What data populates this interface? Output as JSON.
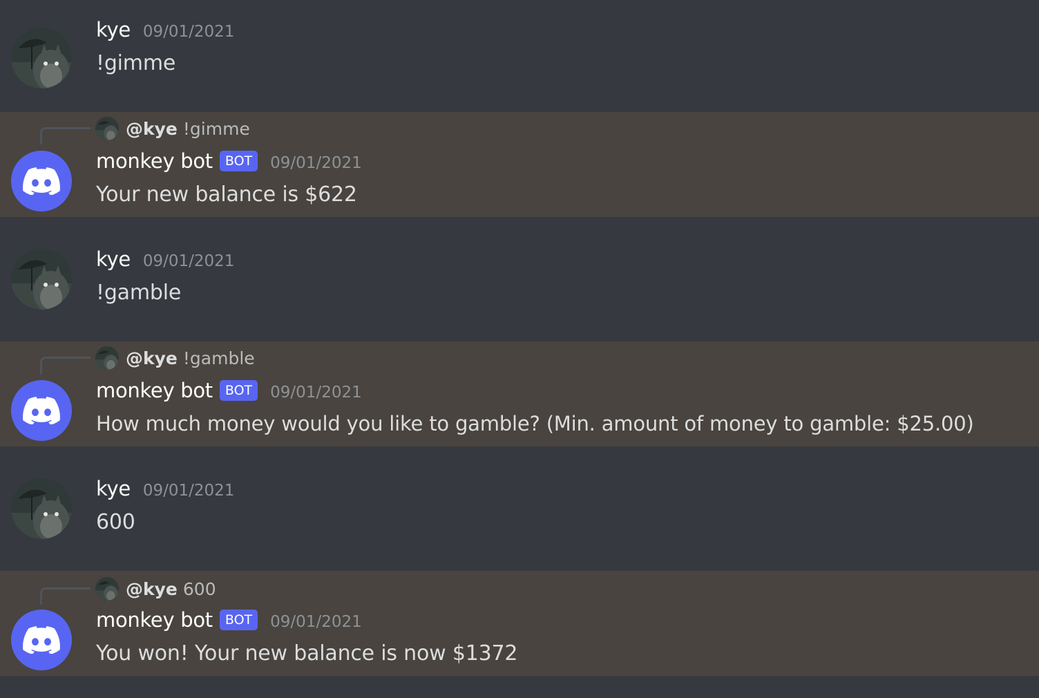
{
  "channel": {
    "messages": [
      {
        "author": "kye",
        "timestamp": "09/01/2021",
        "content": "!gimme"
      },
      {
        "author": "monkey bot",
        "badge": "BOT",
        "timestamp": "09/01/2021",
        "content": "Your new balance is $622",
        "reply": {
          "author": "@kye",
          "content": "!gimme"
        }
      },
      {
        "author": "kye",
        "timestamp": "09/01/2021",
        "content": "!gamble"
      },
      {
        "author": "monkey bot",
        "badge": "BOT",
        "timestamp": "09/01/2021",
        "content": "How much money would you like to gamble? (Min. amount of money to gamble: $25.00)",
        "reply": {
          "author": "@kye",
          "content": "!gamble"
        }
      },
      {
        "author": "kye",
        "timestamp": "09/01/2021",
        "content": "600"
      },
      {
        "author": "monkey bot",
        "badge": "BOT",
        "timestamp": "09/01/2021",
        "content": "You won! Your new balance is now $1372",
        "reply": {
          "author": "@kye",
          "content": "600"
        }
      }
    ]
  },
  "icons": {
    "user_avatar": "totoro-avatar-icon",
    "bot_avatar": "discord-logo-icon"
  },
  "colors": {
    "background": "#36393f",
    "mention_highlight": "#49443f",
    "blurple": "#5865f2",
    "timestamp": "#8e9297",
    "text": "#dcddde"
  }
}
